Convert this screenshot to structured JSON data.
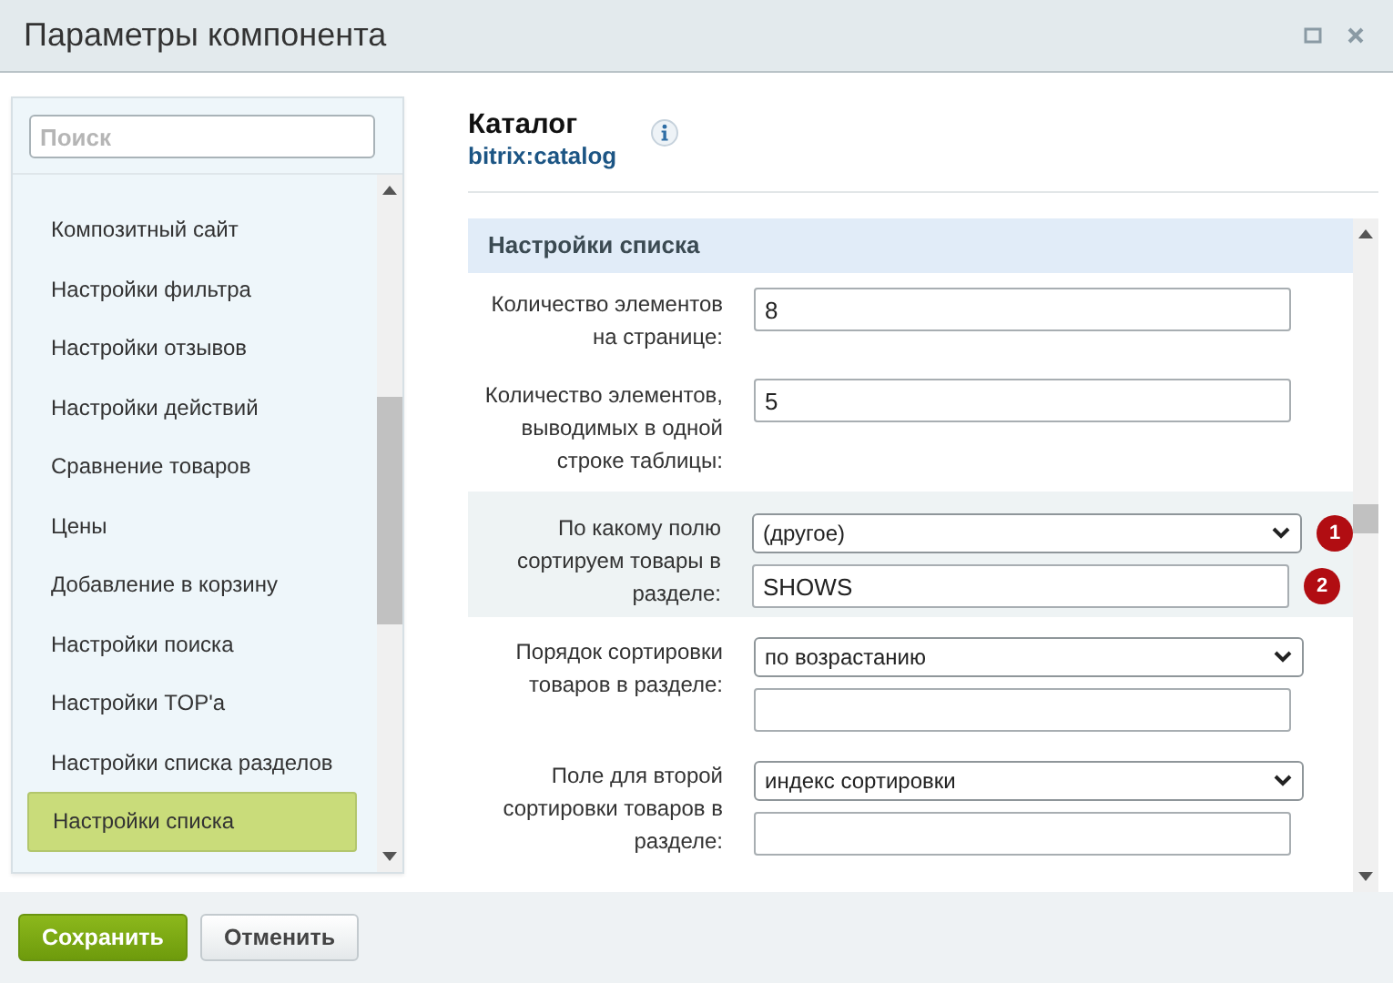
{
  "window": {
    "title": "Параметры компонента"
  },
  "sidebar": {
    "search": {
      "placeholder": "Поиск"
    },
    "items": [
      {
        "label": "Композитный сайт",
        "selected": false
      },
      {
        "label": "Настройки фильтра",
        "selected": false
      },
      {
        "label": "Настройки отзывов",
        "selected": false
      },
      {
        "label": "Настройки действий",
        "selected": false
      },
      {
        "label": "Сравнение товаров",
        "selected": false
      },
      {
        "label": "Цены",
        "selected": false
      },
      {
        "label": "Добавление в корзину",
        "selected": false
      },
      {
        "label": "Настройки поиска",
        "selected": false
      },
      {
        "label": "Настройки TOP'a",
        "selected": false
      },
      {
        "label": "Настройки списка разделов",
        "selected": false
      },
      {
        "label": "Настройки списка",
        "selected": true
      }
    ]
  },
  "component": {
    "title": "Каталог",
    "code": "bitrix:catalog"
  },
  "section": {
    "title": "Настройки списка",
    "rows": [
      {
        "label": "Количество элементов на странице:",
        "highlighted": false,
        "controls": [
          {
            "kind": "text",
            "value": "8"
          }
        ]
      },
      {
        "label": "Количество элементов, выводимых в одной строке таблицы:",
        "highlighted": false,
        "controls": [
          {
            "kind": "text",
            "value": "5"
          }
        ]
      },
      {
        "label": "По какому полю сортируем товары в разделе:",
        "highlighted": true,
        "controls": [
          {
            "kind": "select",
            "value": "(другое)",
            "badge": "1"
          },
          {
            "kind": "text",
            "value": "SHOWS",
            "badge": "2"
          }
        ]
      },
      {
        "label": "Порядок сортировки товаров в разделе:",
        "highlighted": false,
        "controls": [
          {
            "kind": "select",
            "value": "по возрастанию"
          },
          {
            "kind": "text"
          }
        ]
      },
      {
        "label": "Поле для второй сортировки товаров в разделе:",
        "highlighted": false,
        "controls": [
          {
            "kind": "select",
            "value": "индекс сортировки"
          },
          {
            "kind": "text"
          }
        ]
      }
    ]
  },
  "buttons": [
    {
      "label": "Сохранить",
      "kind": "primary"
    },
    {
      "label": "Отменить",
      "kind": "secondary"
    }
  ]
}
